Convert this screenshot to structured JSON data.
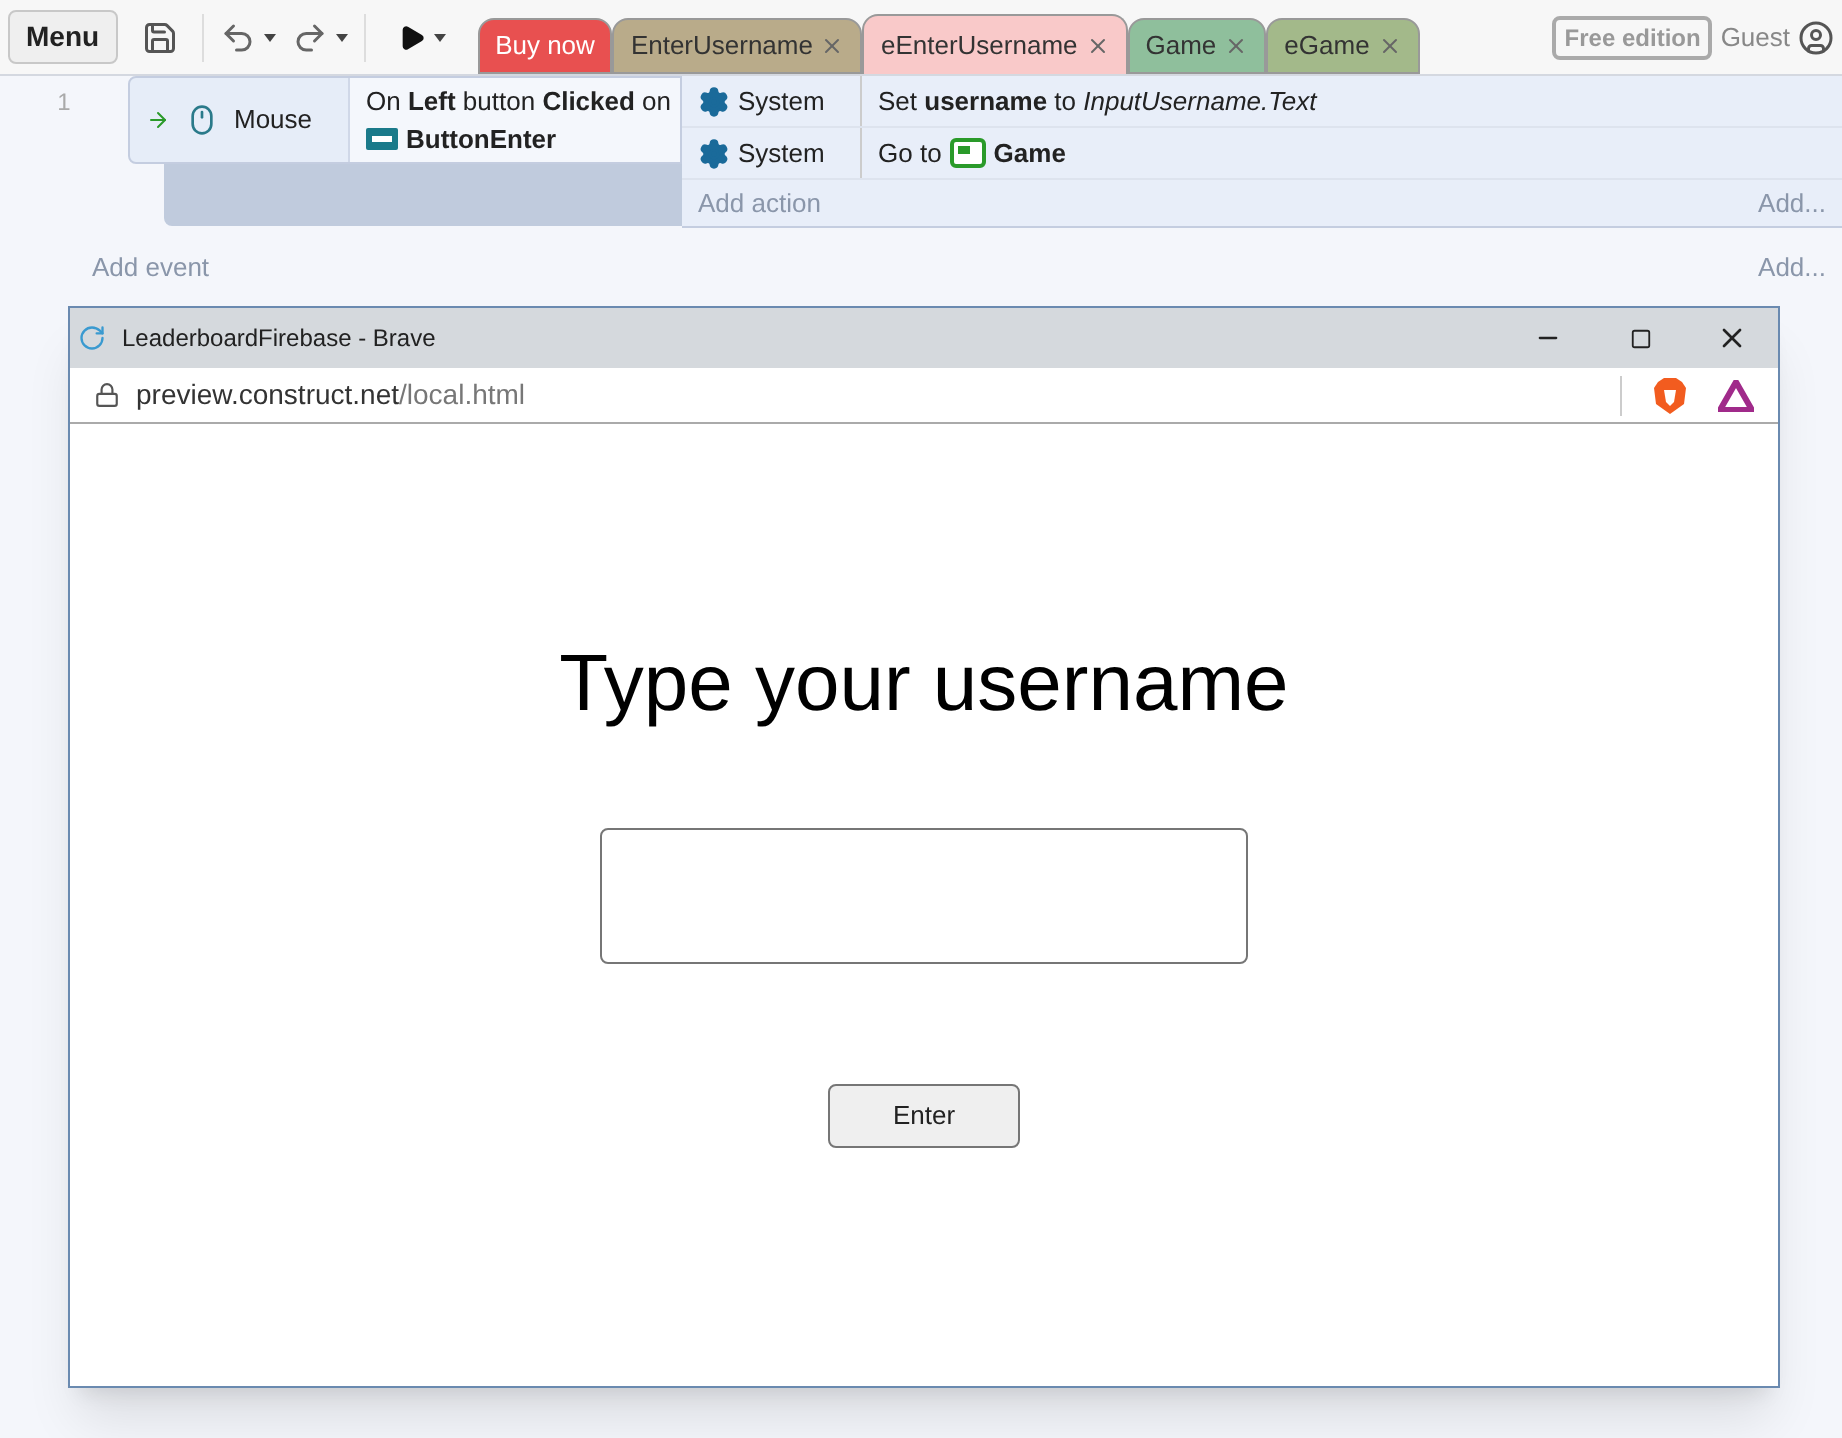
{
  "toolbar": {
    "menu": "Menu"
  },
  "tabs": [
    {
      "label": "Buy now",
      "color": "#e85050",
      "closable": false,
      "selected": false
    },
    {
      "label": "EnterUsername",
      "color": "#b9ab8a",
      "closable": true,
      "selected": false
    },
    {
      "label": "eEnterUsername",
      "color": "#f9c9c9",
      "closable": true,
      "selected": true
    },
    {
      "label": "Game",
      "color": "#8fbf9c",
      "closable": true,
      "selected": false
    },
    {
      "label": "eGame",
      "color": "#a3b98a",
      "closable": true,
      "selected": false
    }
  ],
  "account": {
    "edition": "Free edition",
    "user": "Guest"
  },
  "events": [
    {
      "number": "1",
      "condition": {
        "object": "Mouse",
        "text": "On **Left** button **Clicked** on",
        "target": "ButtonEnter"
      },
      "actions": [
        {
          "object": "System",
          "text": "Set **username** to *InputUsername.Text*"
        },
        {
          "object": "System",
          "text": "Go to",
          "target": "Game"
        }
      ],
      "add_action": "Add action",
      "add_link": "Add..."
    }
  ],
  "add_event": "Add event",
  "add_event_link": "Add...",
  "browser": {
    "title": "LeaderboardFirebase - Brave",
    "url_host": "preview.construct.net",
    "url_path": "/local.html",
    "page": {
      "heading": "Type your username",
      "button": "Enter"
    }
  }
}
